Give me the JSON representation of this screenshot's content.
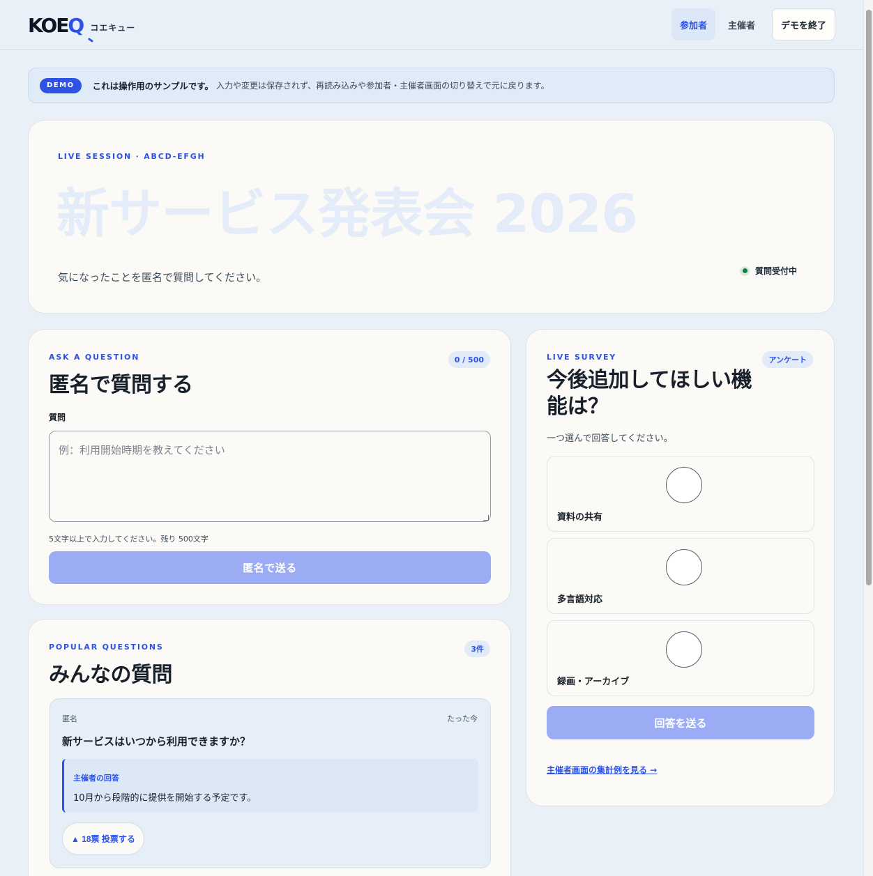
{
  "header": {
    "logo_text": "KOE",
    "logo_q": "Q",
    "logo_sub": "コエキュー",
    "nav": {
      "participant": "参加者",
      "organizer": "主催者",
      "end_demo": "デモを終了"
    }
  },
  "demo_banner": {
    "badge": "DEMO",
    "strong": "これは操作用のサンプルです。",
    "text": "入力や変更は保存されず、再読み込みや参加者・主催者画面の切り替えで元に戻ります。"
  },
  "hero": {
    "eyebrow": "LIVE SESSION · ABCD-EFGH",
    "title": "新サービス発表会 2026",
    "description": "気になったことを匿名で質問してください。",
    "status": "質問受付中"
  },
  "ask": {
    "eyebrow": "ASK A QUESTION",
    "counter": "0 / 500",
    "title": "匿名で質問する",
    "field_label": "質問",
    "placeholder": "例：利用開始時期を教えてください",
    "hint": "5文字以上で入力してください。残り 500文字",
    "submit": "匿名で送る"
  },
  "popular": {
    "eyebrow": "POPULAR QUESTIONS",
    "count": "3件",
    "title": "みんなの質問",
    "questions": [
      {
        "author": "匿名",
        "time": "たった今",
        "text": "新サービスはいつから利用できますか？",
        "answer_label": "主催者の回答",
        "answer": "10月から段階的に提供を開始する予定です。",
        "vote": "▲ 18票 投票する"
      }
    ]
  },
  "survey": {
    "eyebrow": "LIVE SURVEY",
    "badge": "アンケート",
    "title": "今後追加してほしい機能は？",
    "subtitle": "一つ選んで回答してください。",
    "options": [
      "資料の共有",
      "多言語対応",
      "録画・アーカイブ"
    ],
    "submit": "回答を送る",
    "link": "主催者画面の集計例を見る →"
  },
  "colors": {
    "accent": "#2d53e6",
    "background": "#eaf0f7",
    "card": "#fcfaf6",
    "button_disabled": "#9bacf5",
    "status_green": "#168048"
  }
}
